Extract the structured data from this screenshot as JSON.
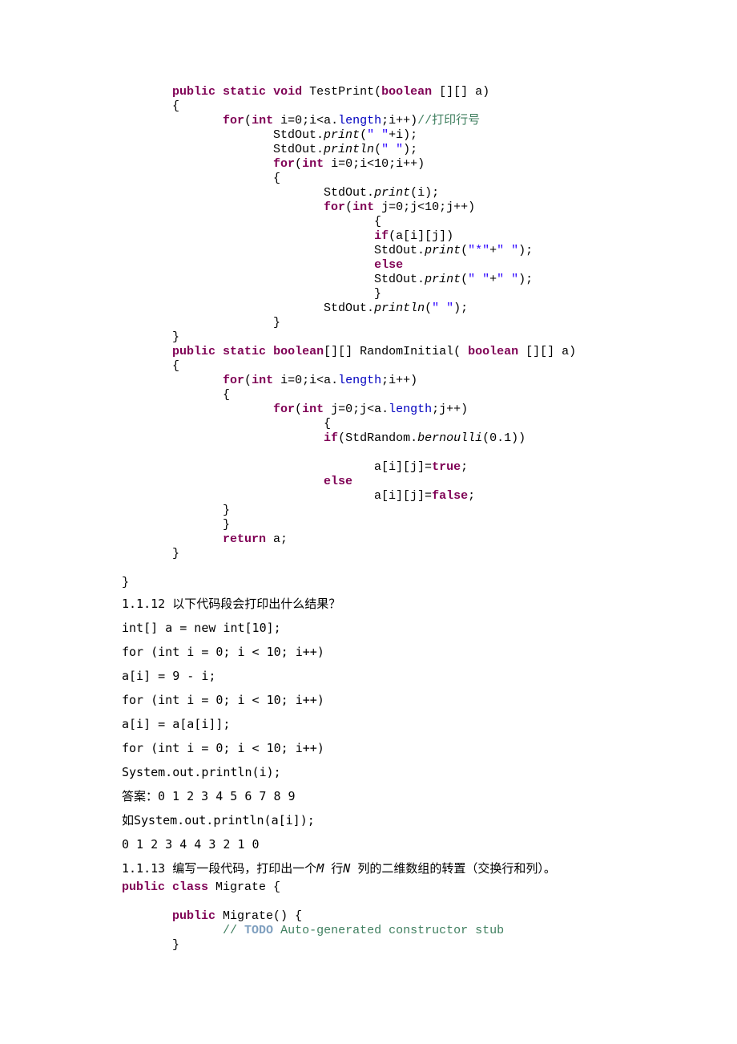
{
  "code_test_print": "       public static void TestPrint(boolean [][] a)\n       {\n              for(int i=0;i<a.length;i++)//打印行号\n                     StdOut.print(\" \"+i);\n                     StdOut.println(\" \");\n                     for(int i=0;i<10;i++)\n                     {\n                            StdOut.print(i);\n                            for(int j=0;j<10;j++)\n                                   {\n                                   if(a[i][j])\n                                   StdOut.print(\"*\"+\" \");\n                                   else\n                                   StdOut.print(\" \"+\" \");\n                                   }\n                            StdOut.println(\" \");\n                     }\n       }\n       public static boolean[][] RandomInitial( boolean [][] a)\n       {\n              for(int i=0;i<a.length;i++)\n              {\n                     for(int j=0;j<a.length;j++)\n                            {\n                            if(StdRandom.bernoulli(0.1))\n\n                                   a[i][j]=true;\n                            else\n                                   a[i][j]=false;\n              }\n              }\n              return a;\n       }\n\n}",
  "q112_title": "1.1.12 以下代码段会打印出什么结果？",
  "q112_code_1": "int[] a = new int[10];",
  "q112_code_2": "for (int i = 0; i < 10; i++)",
  "q112_code_3": "a[i] = 9 - i;",
  "q112_code_4": "for (int i = 0; i < 10; i++)",
  "q112_code_5": "a[i] = a[a[i]];",
  "q112_code_6": "for (int i = 0; i < 10; i++)",
  "q112_code_7": "System.out.println(i);",
  "q112_ans_1": "答案：0 1 2 3 4 5 6 7 8 9",
  "q112_ans_2": "如System.out.println(a[i]);",
  "q112_ans_3": "0 1 2 3 4 4 3 2 1 0",
  "q113_prefix": "1.1.13 编写一段代码，打印出一个",
  "q113_m": "M",
  "q113_mid1": " 行",
  "q113_n": "N",
  "q113_suffix": " 列的二维数组的转置（交换行和列）。",
  "code_migrate": "public class Migrate {\n\n       public Migrate() {\n              // TODO Auto-generated constructor stub\n       }"
}
